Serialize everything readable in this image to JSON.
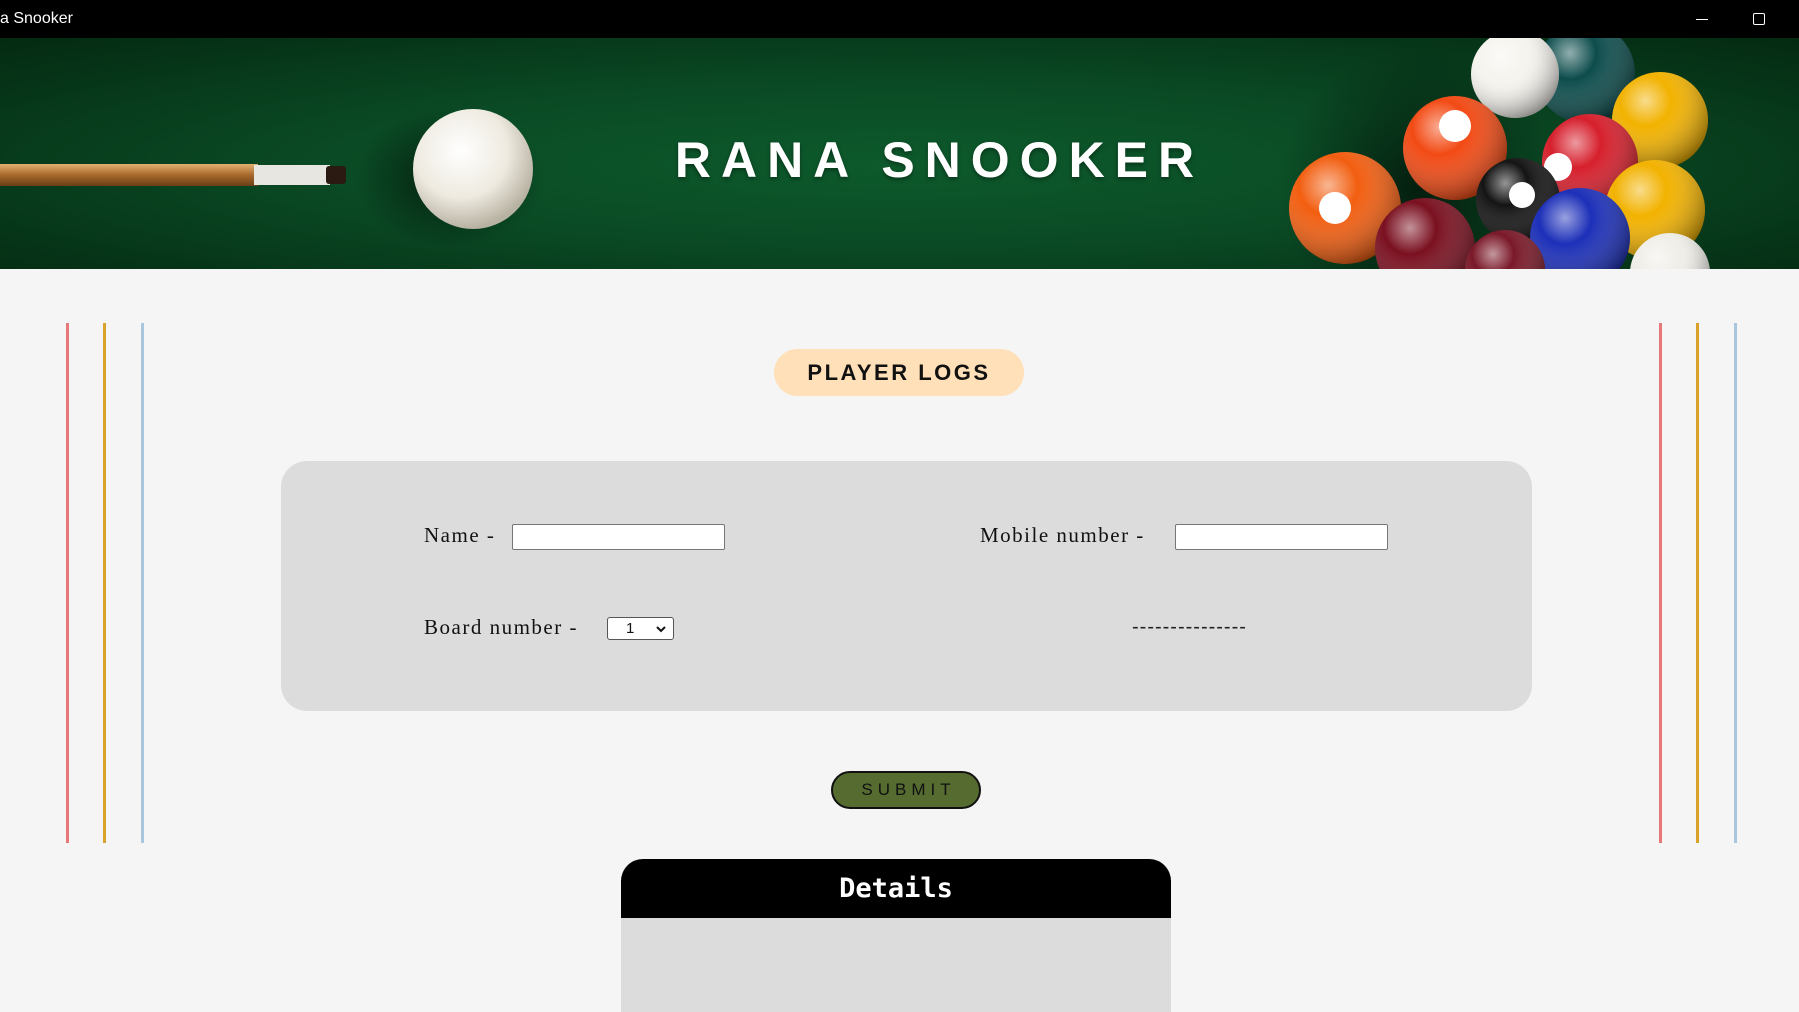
{
  "window": {
    "title": "a Snooker",
    "minimize_icon": "minimize-icon",
    "maximize_icon": "maximize-icon"
  },
  "banner": {
    "title": "RANA SNOOKER",
    "image": "pool-table-with-cue-and-balls"
  },
  "side_lines": {
    "colors": [
      "#e87878",
      "#d9a22a",
      "#a9c6de"
    ]
  },
  "section": {
    "title": "PLAYER LOGS",
    "pill_color": "#ffe0b8"
  },
  "form": {
    "name_label": "Name -",
    "name_value": "",
    "mobile_label": "Mobile number -",
    "mobile_value": "",
    "board_label": "Board number -",
    "board_selected": "1",
    "placeholder_text": "---------------",
    "submit_label": "SUBMIT",
    "submit_color": "#556b2f"
  },
  "details": {
    "title": "Details"
  }
}
